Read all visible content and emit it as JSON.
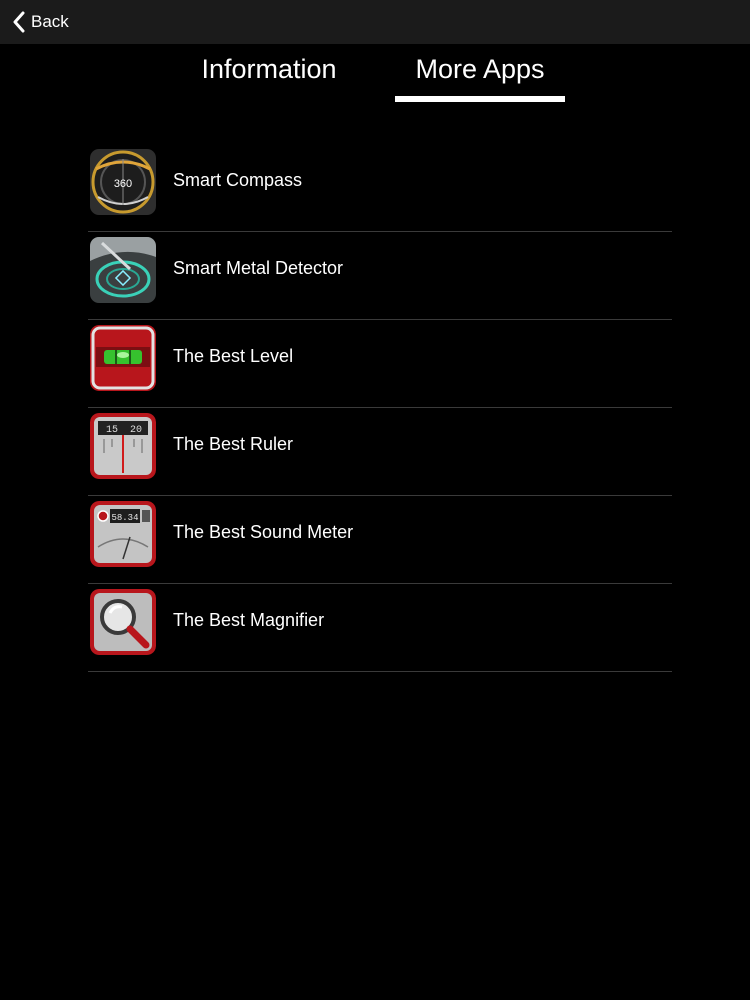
{
  "navbar": {
    "back_label": "Back"
  },
  "tabs": [
    {
      "label": "Information",
      "selected": false
    },
    {
      "label": "More Apps",
      "selected": true
    }
  ],
  "apps": [
    {
      "name": "Smart Compass",
      "icon": "compass-app-icon",
      "icon_text": "360"
    },
    {
      "name": "Smart Metal Detector",
      "icon": "metal-detector-app-icon"
    },
    {
      "name": "The Best Level",
      "icon": "level-app-icon"
    },
    {
      "name": "The Best Ruler",
      "icon": "ruler-app-icon",
      "icon_text_a": "15",
      "icon_text_b": "20"
    },
    {
      "name": "The Best Sound Meter",
      "icon": "sound-meter-app-icon",
      "icon_text": "58.34"
    },
    {
      "name": "The Best Magnifier",
      "icon": "magnifier-app-icon"
    }
  ],
  "colors": {
    "background": "#000000",
    "navbar": "#1b1b1b",
    "divider": "#3a3a3a",
    "icon_red": "#b8161c"
  }
}
